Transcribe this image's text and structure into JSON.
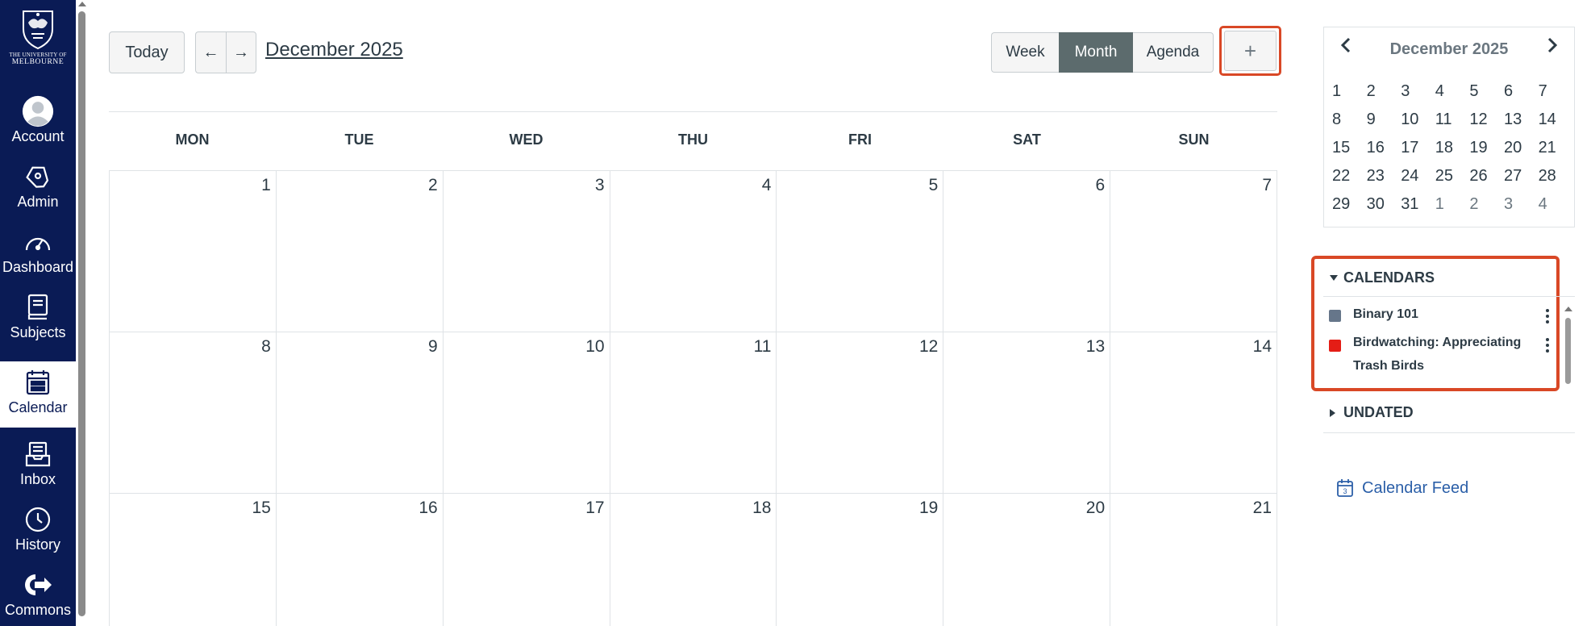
{
  "nav": {
    "logo": {
      "line1": "THE UNIVERSITY OF",
      "line2": "MELBOURNE"
    },
    "items": [
      {
        "label": "Account",
        "icon": "account-icon"
      },
      {
        "label": "Admin",
        "icon": "admin-shield-icon"
      },
      {
        "label": "Dashboard",
        "icon": "dashboard-gauge-icon"
      },
      {
        "label": "Subjects",
        "icon": "subjects-book-icon"
      },
      {
        "label": "Calendar",
        "icon": "calendar-icon",
        "active": true
      },
      {
        "label": "Inbox",
        "icon": "inbox-icon"
      },
      {
        "label": "History",
        "icon": "history-clock-icon"
      },
      {
        "label": "Commons",
        "icon": "commons-icon"
      }
    ]
  },
  "toolbar": {
    "today_label": "Today",
    "prev_label": "←",
    "next_label": "→",
    "month_title": "December 2025",
    "views": {
      "week": "Week",
      "month": "Month",
      "agenda": "Agenda"
    },
    "active_view": "Month",
    "add_label": "+"
  },
  "calendar": {
    "weekdays": [
      "MON",
      "TUE",
      "WED",
      "THU",
      "FRI",
      "SAT",
      "SUN"
    ],
    "weeks": [
      [
        "1",
        "2",
        "3",
        "4",
        "5",
        "6",
        "7"
      ],
      [
        "8",
        "9",
        "10",
        "11",
        "12",
        "13",
        "14"
      ],
      [
        "15",
        "16",
        "17",
        "18",
        "19",
        "20",
        "21"
      ]
    ]
  },
  "mini_calendar": {
    "title": "December 2025",
    "prev": "‹",
    "next": "›",
    "rows": [
      [
        "1",
        "2",
        "3",
        "4",
        "5",
        "6",
        "7"
      ],
      [
        "8",
        "9",
        "10",
        "11",
        "12",
        "13",
        "14"
      ],
      [
        "15",
        "16",
        "17",
        "18",
        "19",
        "20",
        "21"
      ],
      [
        "22",
        "23",
        "24",
        "25",
        "26",
        "27",
        "28"
      ],
      [
        "29",
        "30",
        "31",
        "1",
        "2",
        "3",
        "4"
      ]
    ]
  },
  "calendars_section": {
    "title": "CALENDARS",
    "items": [
      {
        "name": "Binary 101",
        "color": "#66768a"
      },
      {
        "name": "Birdwatching: Appreciating Trash Birds",
        "color": "#e41d16"
      }
    ]
  },
  "undated_section": {
    "title": "UNDATED"
  },
  "feed": {
    "label": "Calendar Feed"
  },
  "colors": {
    "nav_bg": "#0a1b55",
    "highlight": "#d94826",
    "active_view": "#5c6b6d",
    "link": "#2b5fa8"
  }
}
